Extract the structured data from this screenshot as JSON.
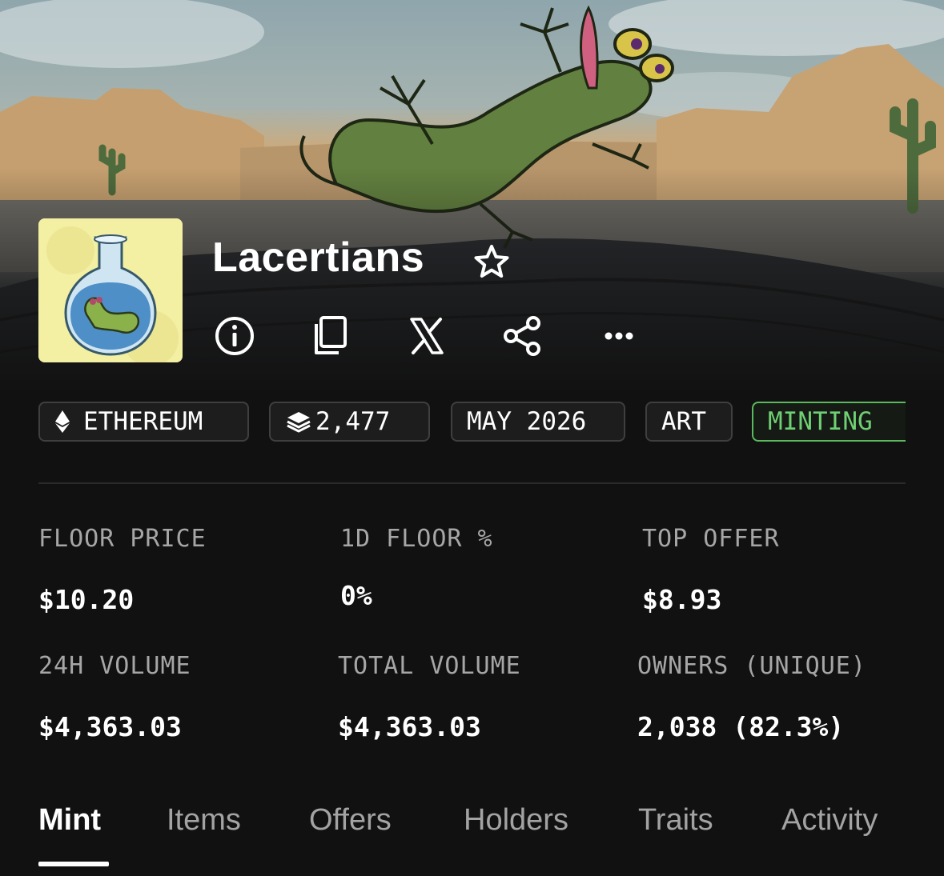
{
  "collection": {
    "name": "Lacertians"
  },
  "chips": [
    {
      "icon": "ethereum-icon",
      "label": "ETHEREUM"
    },
    {
      "icon": "layers-icon",
      "label": "2,477"
    },
    {
      "icon": "",
      "label": "MAY 2026"
    },
    {
      "icon": "",
      "label": "ART"
    },
    {
      "icon": "",
      "label": "MINTING"
    }
  ],
  "stats": [
    {
      "label": "FLOOR PRICE",
      "value": "$10.20"
    },
    {
      "label": "1D FLOOR %",
      "value": "0%"
    },
    {
      "label": "TOP OFFER",
      "value": "$8.93"
    },
    {
      "label": "24H VOLUME",
      "value": "$4,363.03"
    },
    {
      "label": "TOTAL VOLUME",
      "value": "$4,363.03"
    },
    {
      "label": "OWNERS (UNIQUE)",
      "value": "2,038 (82.3%)"
    }
  ],
  "tabs": [
    "Mint",
    "Items",
    "Offers",
    "Holders",
    "Traits",
    "Activity"
  ],
  "active_tab": "Mint",
  "colors": {
    "background": "#111111",
    "minting_accent": "#5cb85c",
    "chip_border": "#3f3f3f"
  }
}
